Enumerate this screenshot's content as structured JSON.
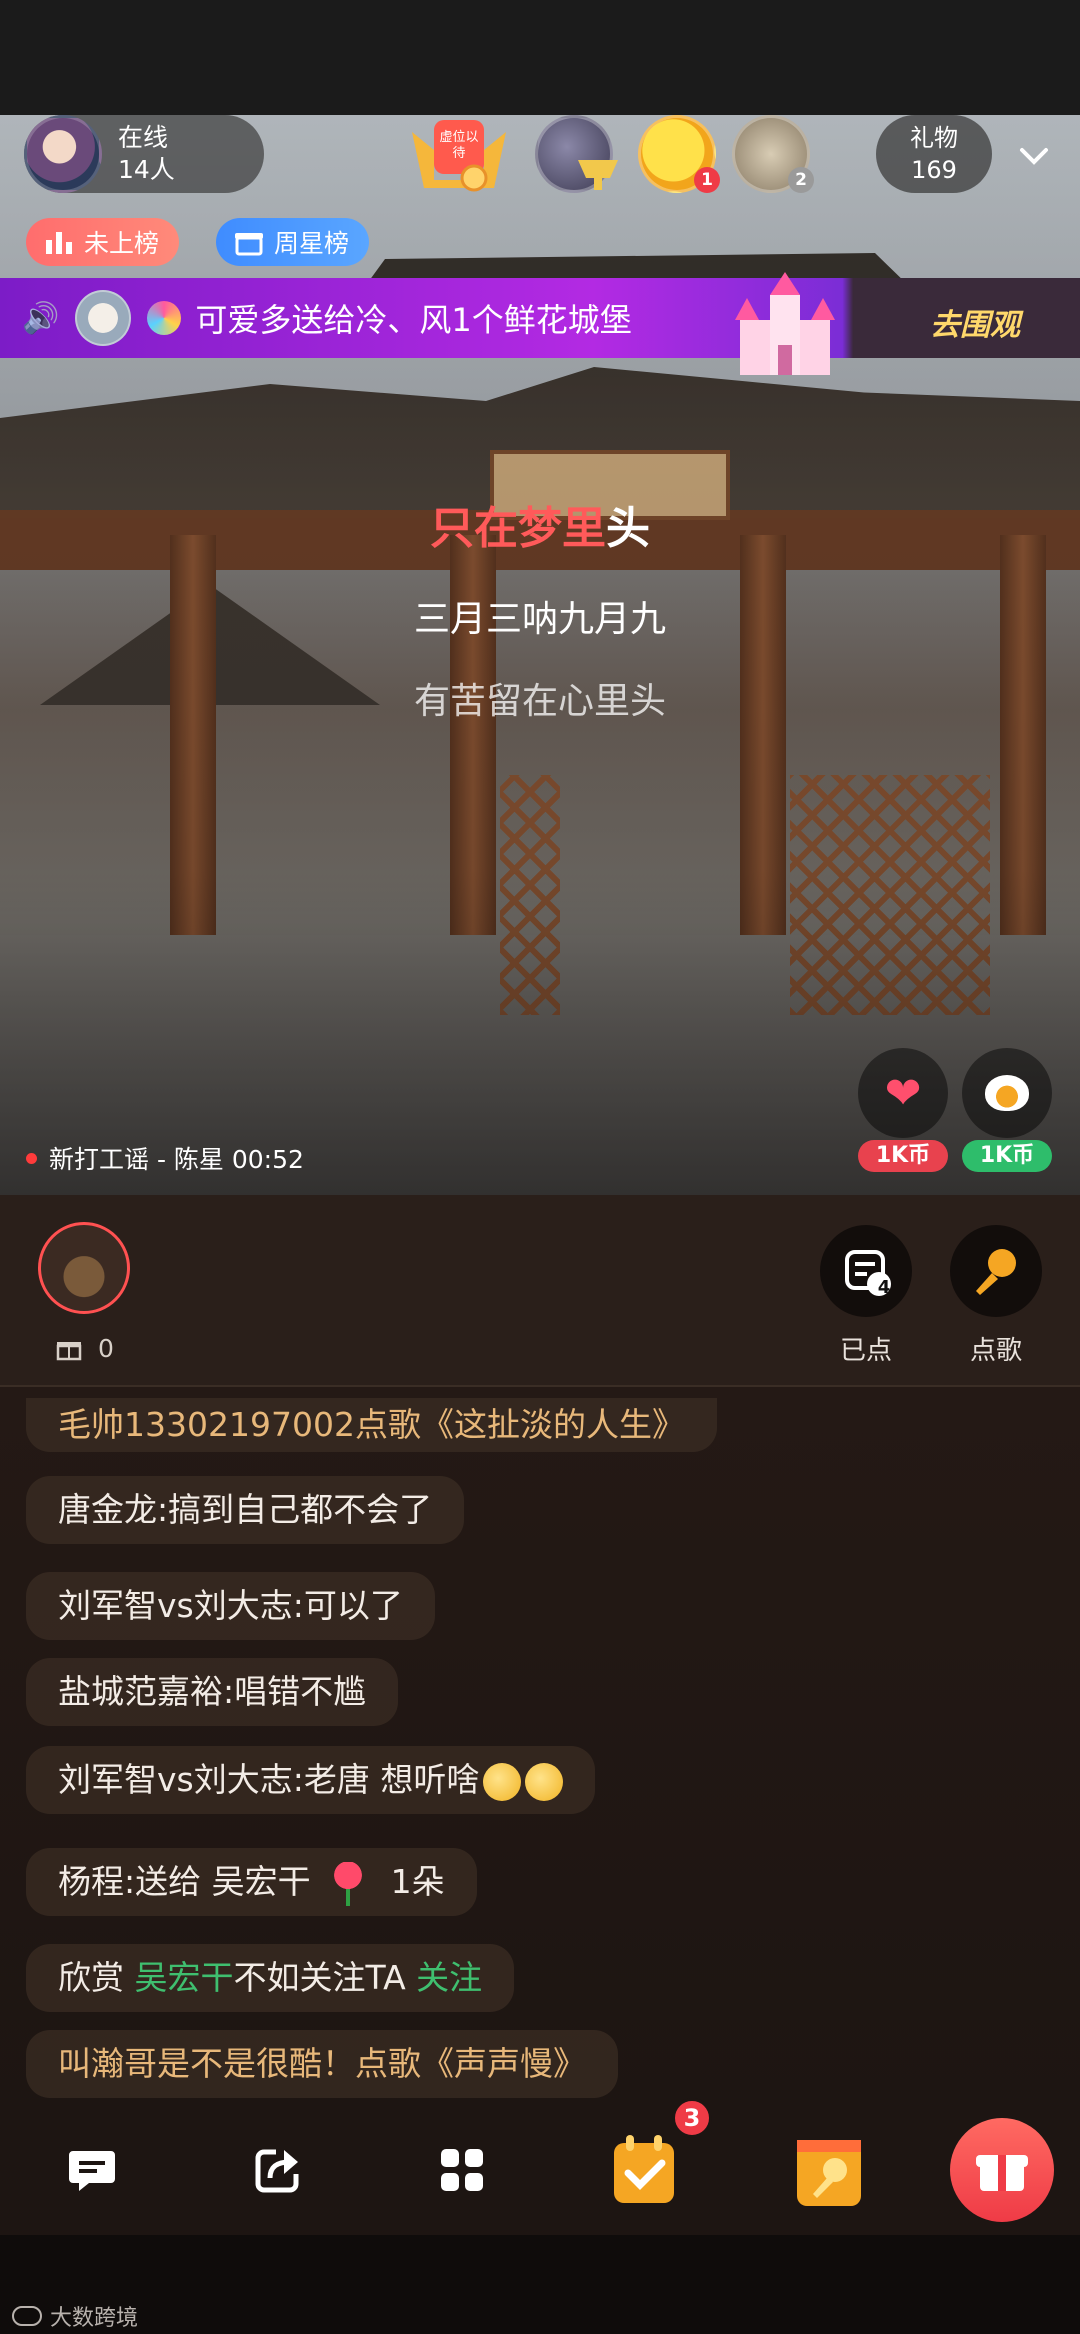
{
  "header": {
    "online_label": "在线",
    "online_count": "14人",
    "gift_label": "礼物",
    "gift_count": "169",
    "rank_not_listed": "未上榜",
    "weekly_star": "周星榜",
    "top_badge_text": "虚位以待",
    "top_user_badges": [
      "1",
      "2"
    ]
  },
  "broadcast": {
    "message": "可爱多送给冷、风1个鲜花城堡",
    "cta": "去围观"
  },
  "lyrics": {
    "line1_highlight": "只在梦里",
    "line1_rest": "头",
    "line2": "三月三呐九月九",
    "line3": "有苦留在心里头"
  },
  "now_playing": "新打工谣 - 陈星 00:52",
  "video_actions": [
    {
      "icon": "heart-icon",
      "price": "1K币",
      "color": "#e8424e"
    },
    {
      "icon": "egg-icon",
      "price": "1K币",
      "color": "#2ebd6b"
    }
  ],
  "host_panel": {
    "gift_count": "0",
    "requested_badge": "4",
    "requested_label": "已点",
    "request_song_label": "点歌"
  },
  "chat": [
    {
      "user": "毛帅13302197002",
      "text": "点歌《这扯淡的人生》"
    },
    {
      "user": "唐金龙",
      "text": ":搞到自己都不会了"
    },
    {
      "user": "刘军智vs刘大志",
      "text": ":可以了"
    },
    {
      "user": "盐城范嘉裕",
      "text": ":唱错不尴"
    },
    {
      "user": "刘军智vs刘大志",
      "text": ":老唐  想听啥"
    },
    {
      "user": "杨程",
      "text": ":送给 吴宏干",
      "count": "1朵"
    },
    {
      "prefix": "欣赏 ",
      "name": "吴宏干",
      "middle": "不如关注TA ",
      "action": "关注"
    },
    {
      "user": "叫瀚哥是不是很酷！",
      "text": "点歌《声声慢》"
    }
  ],
  "bottom_bar": {
    "task_badge": "3"
  },
  "watermark": "大数跨境"
}
